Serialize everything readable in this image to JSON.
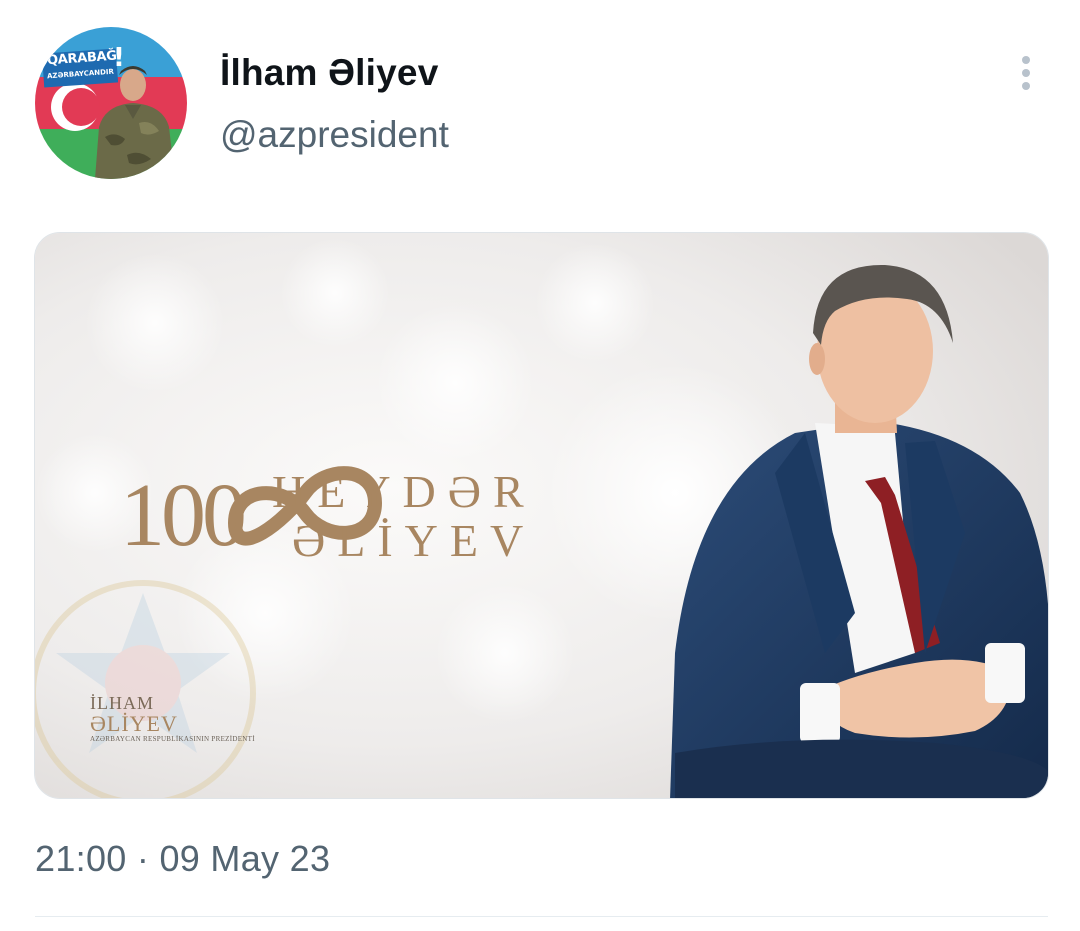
{
  "tweet": {
    "display_name": "İlham Əliyev",
    "handle": "@azpresident",
    "more_icon": "more-vertical-icon",
    "timestamp": "21:00 · 09 May 23"
  },
  "avatar": {
    "badge_line1": "QARABAĞ",
    "badge_mark": "!",
    "badge_line2": "AZƏRBAYCANDIR"
  },
  "media": {
    "number": "100",
    "name_line1": "HEYDƏR",
    "name_line2": "ƏLİYEV",
    "signature_name1": "İLHAM",
    "signature_name2": "ƏLİYEV",
    "signature_title": "AZƏRBAYCAN RESPUBLİKASININ PREZİDENTİ"
  },
  "colors": {
    "text_primary": "#0f1419",
    "text_secondary": "#536471",
    "gold": "#a88661",
    "divider": "#e6ecf0"
  }
}
